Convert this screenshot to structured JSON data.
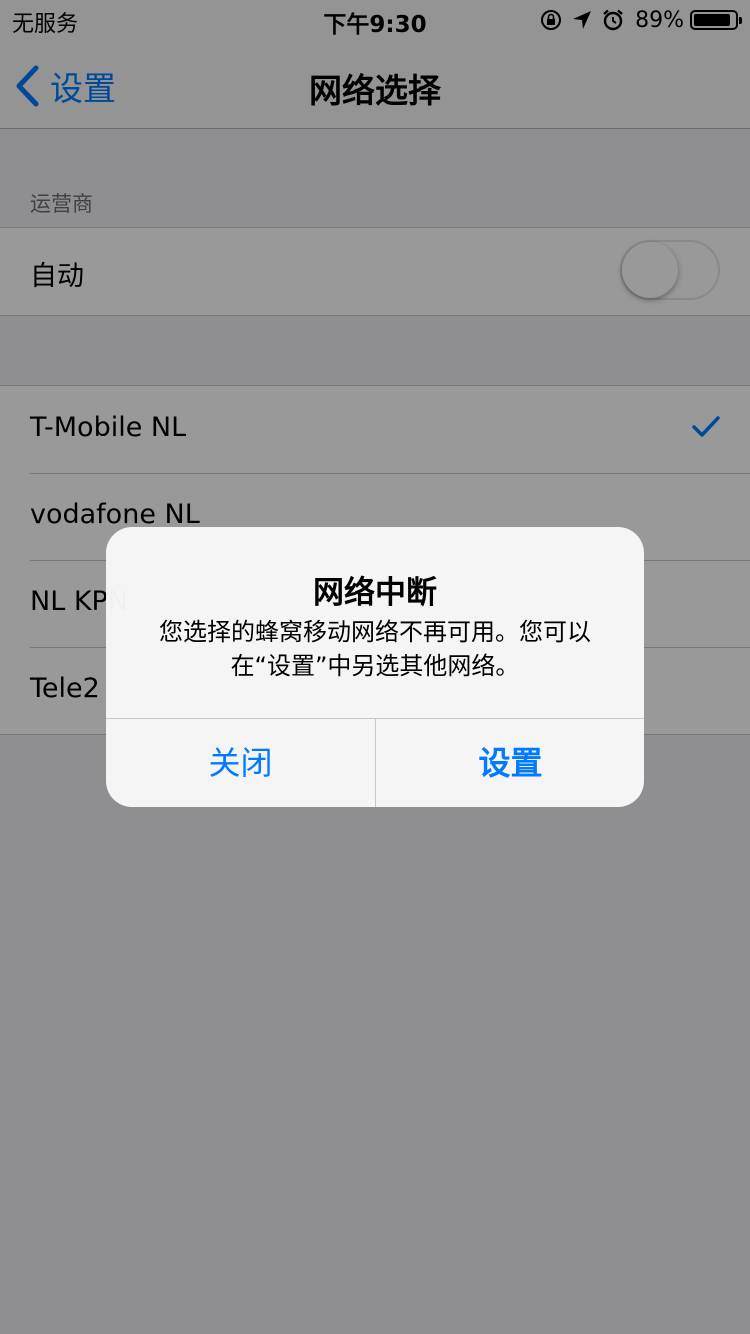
{
  "status_bar": {
    "carrier": "无服务",
    "time": "下午9:30",
    "battery_percent": "89%",
    "battery_level": 0.89,
    "icons": [
      "orientation-lock-icon",
      "location-icon",
      "alarm-icon",
      "battery-icon"
    ]
  },
  "nav": {
    "back_label": "设置",
    "title": "网络选择"
  },
  "carrier_section": {
    "header": "运营商",
    "auto_label": "自动",
    "auto_on": false
  },
  "networks": [
    {
      "label": "T-Mobile NL",
      "selected": true
    },
    {
      "label": "vodafone NL",
      "selected": false
    },
    {
      "label": "NL KPN",
      "selected": false
    },
    {
      "label": "Tele2",
      "selected": false
    }
  ],
  "alert": {
    "title": "网络中断",
    "message": "您选择的蜂窝移动网络不再可用。您可以在“设置”中另选其他网络。",
    "cancel_label": "关闭",
    "confirm_label": "设置"
  },
  "colors": {
    "accent": "#007aff",
    "background": "#efeff4",
    "overlay": "rgba(0,0,0,0.4)"
  }
}
